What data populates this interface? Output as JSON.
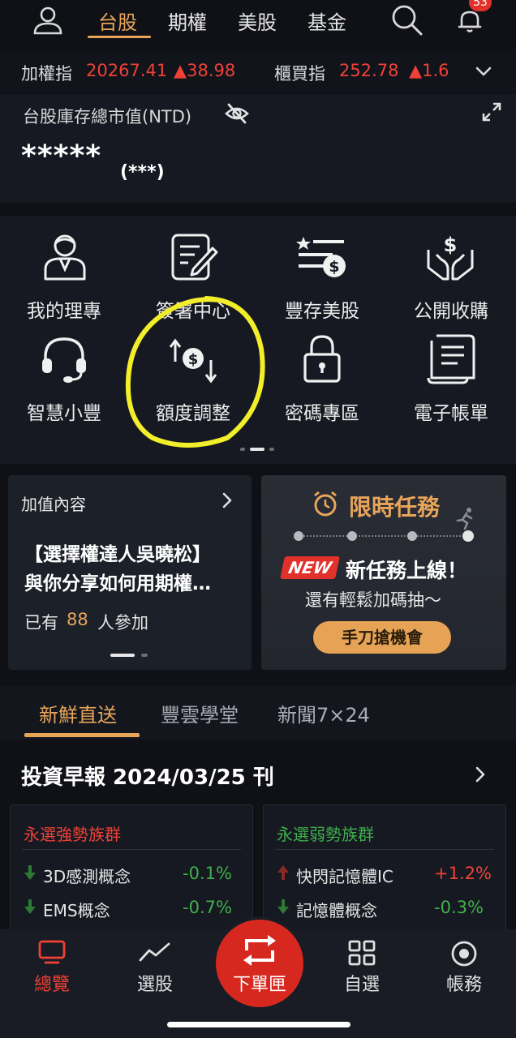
{
  "topnav": {
    "tabs": [
      "台股",
      "期權",
      "美股",
      "基金"
    ],
    "active_tab": "台股",
    "notification_count": "53"
  },
  "ticker": {
    "taiex_label": "加權指",
    "taiex_value": "20267.41",
    "taiex_change": "▲38.98",
    "otc_label": "櫃買指",
    "otc_value": "252.78",
    "otc_change": "▲1.6"
  },
  "asset": {
    "title": "台股庫存總市值(NTD)",
    "value": "*****",
    "sub_value": "(***)"
  },
  "shortcuts": [
    {
      "label": "我的理專",
      "icon": "advisor-icon"
    },
    {
      "label": "簽署中心",
      "icon": "sign-doc-icon"
    },
    {
      "label": "豐存美股",
      "icon": "us-stock-saving-icon"
    },
    {
      "label": "公開收購",
      "icon": "tender-offer-icon"
    },
    {
      "label": "智慧小豐",
      "icon": "headset-icon"
    },
    {
      "label": "額度調整",
      "icon": "quota-adjust-icon"
    },
    {
      "label": "密碼專區",
      "icon": "lock-icon"
    },
    {
      "label": "電子帳單",
      "icon": "e-bill-icon"
    }
  ],
  "value_card": {
    "title": "加值內容",
    "line1": "【選擇權達人吳曉松】",
    "line2": "與你分享如何用期權…",
    "participants_prefix": "已有",
    "participants_count": "88",
    "participants_suffix": "人參加"
  },
  "task_card": {
    "title": "限時任務",
    "new_badge": "NEW",
    "headline": "新任務上線！",
    "subline": "還有輕鬆加碼抽～",
    "button": "手刀搶機會"
  },
  "section_tabs": [
    "新鮮直送",
    "豐雲學堂",
    "新聞7×24"
  ],
  "report": {
    "title": "投資早報 2024/03/25 刊"
  },
  "strong_groups": {
    "title": "永選強勢族群",
    "rows": [
      {
        "name": "3D感測概念",
        "change": "-0.1%"
      },
      {
        "name": "EMS概念",
        "change": "-0.7%"
      }
    ]
  },
  "weak_groups": {
    "title": "永選弱勢族群",
    "rows": [
      {
        "name": "快閃記憶體IC",
        "change": "+1.2%"
      },
      {
        "name": "記憶體概念",
        "change": "-0.3%"
      }
    ]
  },
  "bottom_nav": {
    "overview": "總覽",
    "screener": "選股",
    "order": "下單匣",
    "watchlist": "自選",
    "account": "帳務"
  },
  "colors": {
    "accent": "#e8a55a",
    "up": "#ef4137",
    "down": "#3fb04a",
    "highlight_circle": "#f2ee2a"
  }
}
